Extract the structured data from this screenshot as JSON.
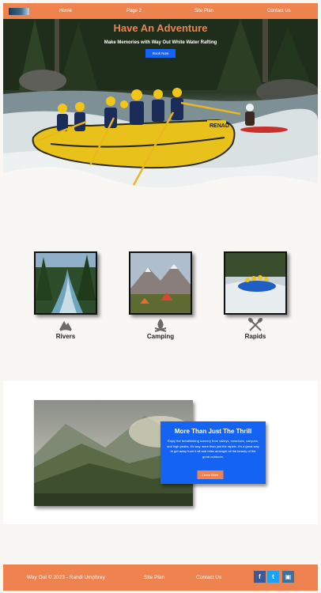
{
  "nav": {
    "items": [
      "Home",
      "Page 2",
      "Site Plan",
      "Contact Us"
    ]
  },
  "hero": {
    "title": "Have An Adventure",
    "subtitle": "Make Memories with Way Out White Water Rafting",
    "button_label": "Book Now",
    "raft_text": "RENAD"
  },
  "features": [
    {
      "label": "Rivers",
      "icon": "rivers-icon"
    },
    {
      "label": "Camping",
      "icon": "campfire-icon"
    },
    {
      "label": "Rapids",
      "icon": "crossed-paddles-icon"
    }
  ],
  "promo": {
    "title": "More Than Just The Thrill",
    "body": "Enjoy the breathtaking scenery from valleys, meadows, canyons, and high peaks, it's way more than just the rapids. It's a great way to get away from it all and relax amongst all the beauty of the great outdoors.",
    "button_label": "Learn More"
  },
  "footer": {
    "copyright": "Way Out © 2023 - Randi Umphrey",
    "site_plan": "Site Plan",
    "contact": "Contact Us",
    "social": [
      {
        "name": "facebook-icon",
        "glyph": "f",
        "color": "#3b5998"
      },
      {
        "name": "twitter-icon",
        "glyph": "t",
        "color": "#1da1f2"
      },
      {
        "name": "instagram-icon",
        "glyph": "▣",
        "color": "#3f729b"
      }
    ]
  },
  "colors": {
    "accent": "#ef8350",
    "primary_blue": "#1463f3",
    "background": "#f9f7f4"
  }
}
